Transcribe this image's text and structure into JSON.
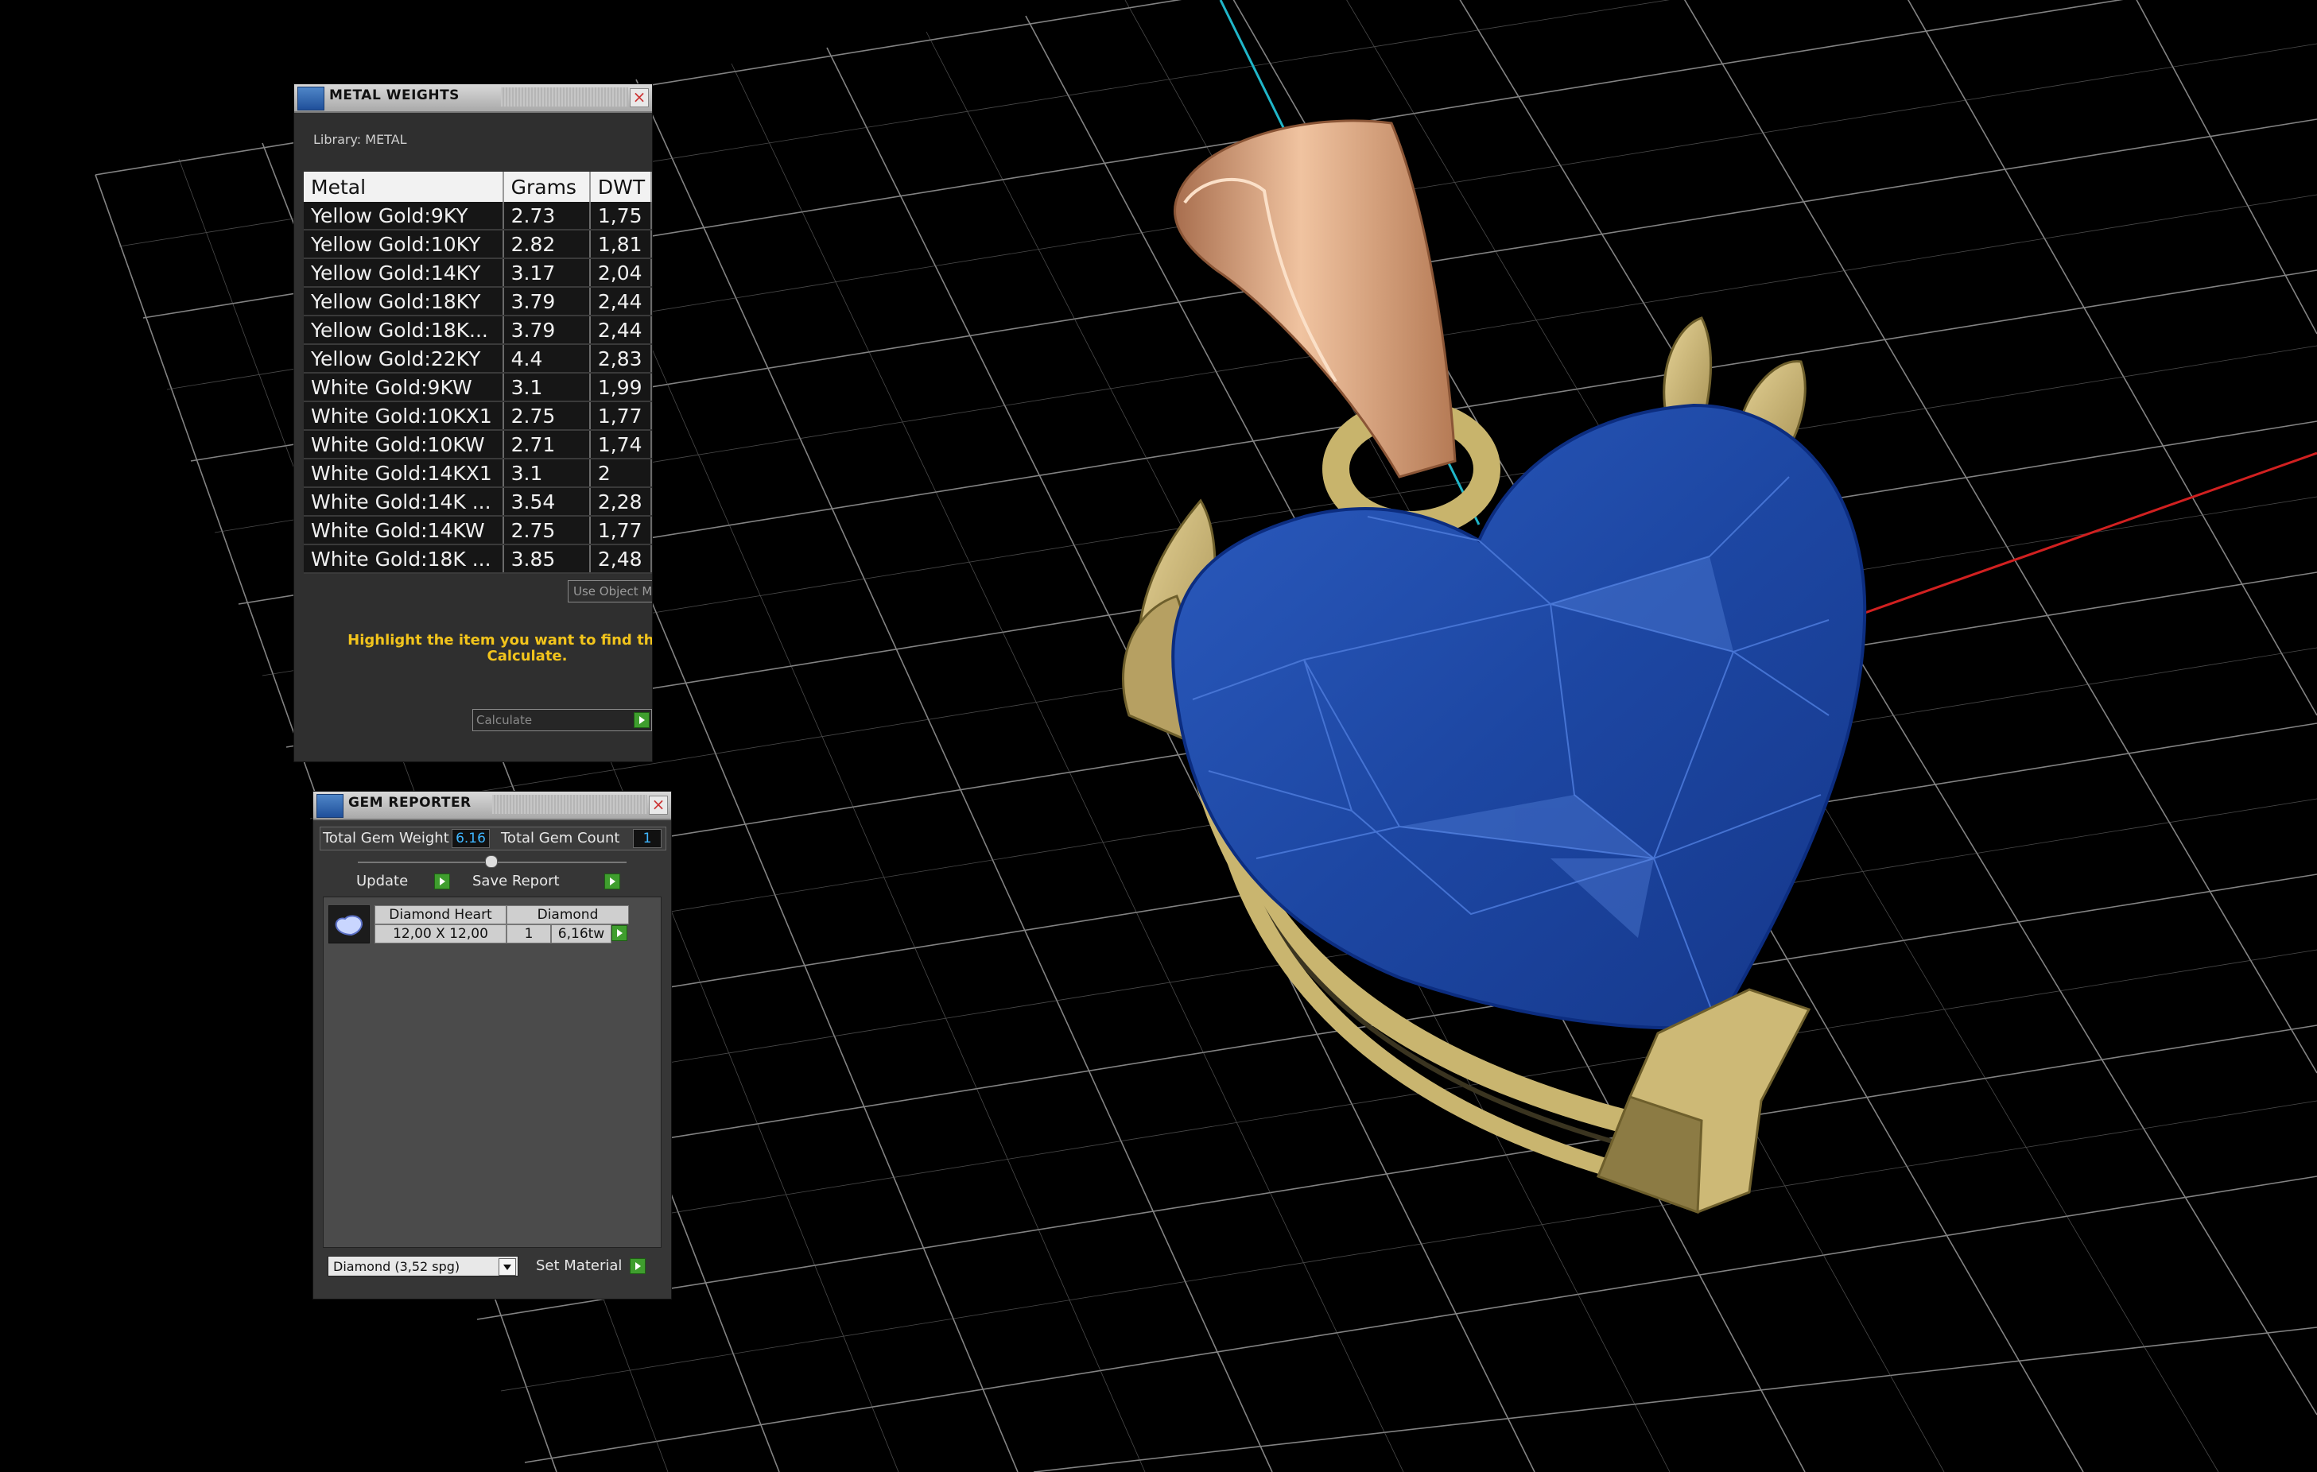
{
  "metal_weights": {
    "title": "METAL WEIGHTS",
    "library": "Library: METAL",
    "columns": [
      "Metal",
      "Grams",
      "DWT"
    ],
    "rows": [
      [
        "Yellow Gold:9KY",
        "2.73",
        "1,75"
      ],
      [
        "Yellow Gold:10KY",
        "2.82",
        "1,81"
      ],
      [
        "Yellow Gold:14KY",
        "3.17",
        "2,04"
      ],
      [
        "Yellow Gold:18KY",
        "3.79",
        "2,44"
      ],
      [
        "Yellow Gold:18K...",
        "3.79",
        "2,44"
      ],
      [
        "Yellow Gold:22KY",
        "4.4",
        "2,83"
      ],
      [
        "White Gold:9KW",
        "3.1",
        "1,99"
      ],
      [
        "White Gold:10KX1",
        "2.75",
        "1,77"
      ],
      [
        "White Gold:10KW",
        "2.71",
        "1,74"
      ],
      [
        "White Gold:14KX1",
        "3.1",
        "2"
      ],
      [
        "White Gold:14K ...",
        "3.54",
        "2,28"
      ],
      [
        "White Gold:14KW",
        "2.75",
        "1,77"
      ],
      [
        "White Gold:18K ...",
        "3.85",
        "2,48"
      ]
    ],
    "use_object_label": "Use Object M",
    "hint_line1": "Highlight the item you want to find the weig",
    "hint_line2": "Calculate.",
    "calculate_label": "Calculate"
  },
  "gem_reporter": {
    "title": "GEM REPORTER",
    "total_weight_label": "Total Gem Weight",
    "total_weight_value": "6.16",
    "total_count_label": "Total Gem Count",
    "total_count_value": "1",
    "update_label": "Update",
    "save_report_label": "Save Report",
    "gem": {
      "shape": "Diamond Heart",
      "material": "Diamond",
      "size": "12,00 X 12,00",
      "count": "1",
      "weight": "6,16tw"
    },
    "material_select": "Diamond     (3,52 spg)",
    "set_material_label": "Set Material"
  },
  "colors": {
    "background": "#000000",
    "grid": "#9a9a9a",
    "gem_blue": "#1f4fae",
    "gold": "#d8c27a",
    "rose_gold": "#d9a07e",
    "axis_x": "#d12020",
    "axis_z": "#20b6c9",
    "hint_yellow": "#f2c41c"
  }
}
